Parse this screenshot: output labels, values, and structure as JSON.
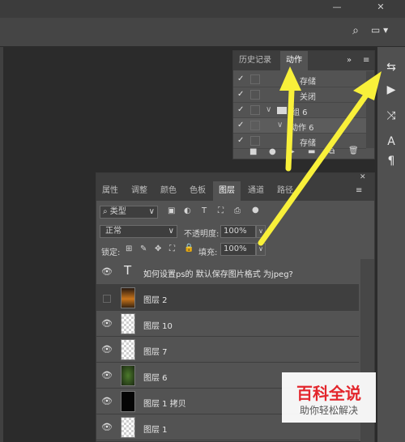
{
  "window": {
    "minimize": "—",
    "close": "✕"
  },
  "optbar": {
    "search": "⌕",
    "layout": "▭"
  },
  "actions_panel": {
    "tabs": [
      {
        "label": "历史记录"
      },
      {
        "label": "动作"
      }
    ],
    "collapse": "»",
    "menu": "≡",
    "rows": [
      {
        "check": "✓",
        "text": "存储"
      },
      {
        "check": "✓",
        "text": "关闭"
      },
      {
        "check": "✓",
        "text": "组 6"
      },
      {
        "check": "✓",
        "text": "动作 6"
      },
      {
        "check": "✓",
        "text": "存储"
      }
    ],
    "footer": [
      "■",
      "●",
      "▶",
      "▬",
      "⧉",
      "🗑"
    ]
  },
  "layers_panel": {
    "tabs": [
      {
        "label": "属性"
      },
      {
        "label": "调整"
      },
      {
        "label": "颜色"
      },
      {
        "label": "色板"
      },
      {
        "label": "图层"
      },
      {
        "label": "通道"
      },
      {
        "label": "路径"
      }
    ],
    "close": "✕",
    "filter": {
      "label": "类型",
      "icons": [
        "▣",
        "◐",
        "T",
        "⛶",
        "⎙",
        "●"
      ]
    },
    "blend_mode": "正常",
    "opacity_label": "不透明度:",
    "opacity_value": "100%",
    "lock_label": "锁定:",
    "lock_icons": [
      "⊞",
      "✎",
      "✥",
      "⛶",
      "🔒"
    ],
    "fill_label": "填充:",
    "fill_value": "100%",
    "text_layer": "如何设置ps的 默认保存图片格式 为jpeg?",
    "text_icon": "T",
    "layers": [
      {
        "name": "图层 2",
        "visible": false
      },
      {
        "name": "图层 10",
        "visible": true
      },
      {
        "name": "图层 7",
        "visible": true
      },
      {
        "name": "图层 6",
        "visible": true
      },
      {
        "name": "图层 1 拷贝",
        "visible": true
      },
      {
        "name": "图层 1",
        "visible": true
      }
    ]
  },
  "right_toolbar": [
    "⇆",
    "▶",
    "⤨",
    "A",
    "¶"
  ],
  "watermark": {
    "title": "百科全说",
    "subtitle": "助你轻松解决"
  },
  "colors": {
    "accent": "#f8f03a",
    "watermark_red": "#e3262c"
  }
}
